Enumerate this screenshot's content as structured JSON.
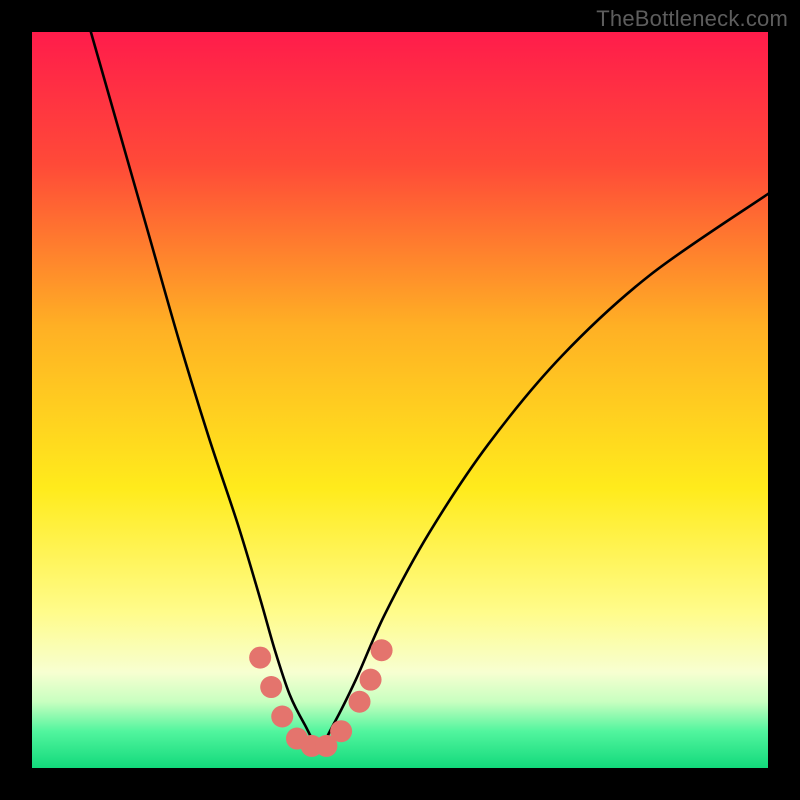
{
  "watermark": "TheBottleneck.com",
  "chart_data": {
    "type": "line",
    "title": "",
    "xlabel": "",
    "ylabel": "",
    "xlim": [
      0,
      100
    ],
    "ylim": [
      0,
      100
    ],
    "grid": false,
    "legend": false,
    "gradient_stops": [
      {
        "pct": 0,
        "color": "#ff1c4b"
      },
      {
        "pct": 18,
        "color": "#ff4a38"
      },
      {
        "pct": 40,
        "color": "#ffb024"
      },
      {
        "pct": 62,
        "color": "#ffeb1c"
      },
      {
        "pct": 79,
        "color": "#fffc8c"
      },
      {
        "pct": 87,
        "color": "#f7ffd1"
      },
      {
        "pct": 91,
        "color": "#c8ffc0"
      },
      {
        "pct": 95,
        "color": "#52f59e"
      },
      {
        "pct": 100,
        "color": "#12d97b"
      }
    ],
    "series": [
      {
        "name": "bottleneck-curve",
        "color": "#000000",
        "x": [
          8,
          12,
          16,
          20,
          24,
          28,
          31,
          33,
          35,
          37,
          39,
          41,
          44,
          48,
          54,
          62,
          72,
          84,
          100
        ],
        "y": [
          100,
          86,
          72,
          58,
          45,
          33,
          23,
          16,
          10,
          6,
          3,
          6,
          12,
          21,
          32,
          44,
          56,
          67,
          78
        ]
      },
      {
        "name": "marker-band",
        "type": "scatter",
        "color": "#e4746d",
        "x": [
          31,
          32.5,
          34,
          36,
          38,
          40,
          42,
          44.5,
          46,
          47.5
        ],
        "y": [
          15,
          11,
          7,
          4,
          3,
          3,
          5,
          9,
          12,
          16
        ]
      }
    ]
  }
}
